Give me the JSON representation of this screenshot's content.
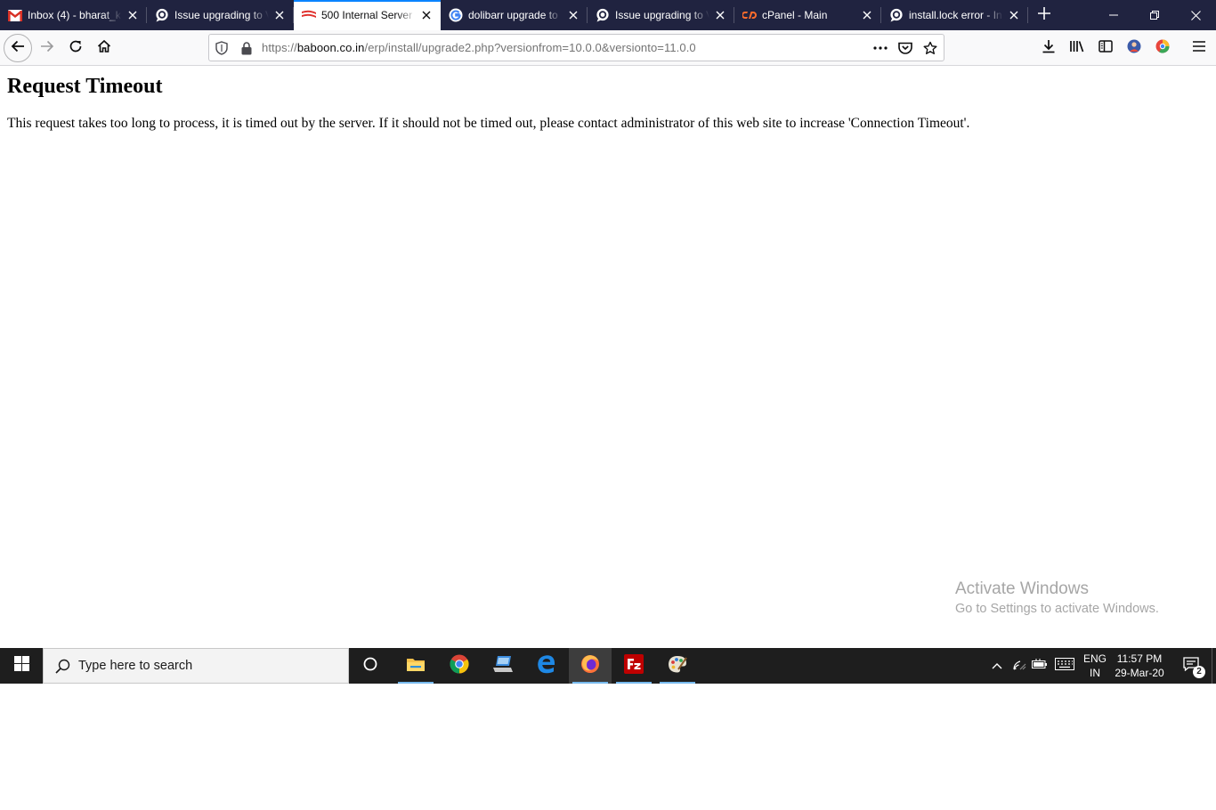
{
  "browser": {
    "tabs": [
      {
        "label": "Inbox (4) - bharat_k",
        "icon": "gmail-icon",
        "active": false
      },
      {
        "label": "Issue upgrading to V",
        "icon": "discourse-icon",
        "active": false
      },
      {
        "label": "500 Internal Server E",
        "icon": "hosting-flag-icon",
        "active": true
      },
      {
        "label": "dolibarr upgrade to",
        "icon": "google-icon",
        "active": false
      },
      {
        "label": "Issue upgrading to V",
        "icon": "discourse-icon",
        "active": false
      },
      {
        "label": "cPanel - Main",
        "icon": "cpanel-icon",
        "active": false
      },
      {
        "label": "install.lock error - In",
        "icon": "discourse-icon",
        "active": false
      }
    ],
    "url": {
      "scheme": "https://",
      "host": "baboon.co.in",
      "path": "/erp/install/upgrade2.php?versionfrom=10.0.0&versionto=11.0.0"
    },
    "accent_color": "#0a84ff"
  },
  "page": {
    "title": "Request Timeout",
    "message": "This request takes too long to process, it is timed out by the server. If it should not be timed out, please contact administrator of this web site to increase 'Connection Timeout'."
  },
  "watermark": {
    "title": "Activate Windows",
    "subtitle": "Go to Settings to activate Windows."
  },
  "taskbar": {
    "search_placeholder": "Type here to search",
    "apps": [
      "cortana",
      "file-explorer",
      "chrome",
      "laptop-app",
      "edge",
      "firefox",
      "filezilla",
      "paint"
    ],
    "language_line1": "ENG",
    "language_line2": "IN",
    "time": "11:57 PM",
    "date": "29-Mar-20",
    "notification_count": "2"
  }
}
